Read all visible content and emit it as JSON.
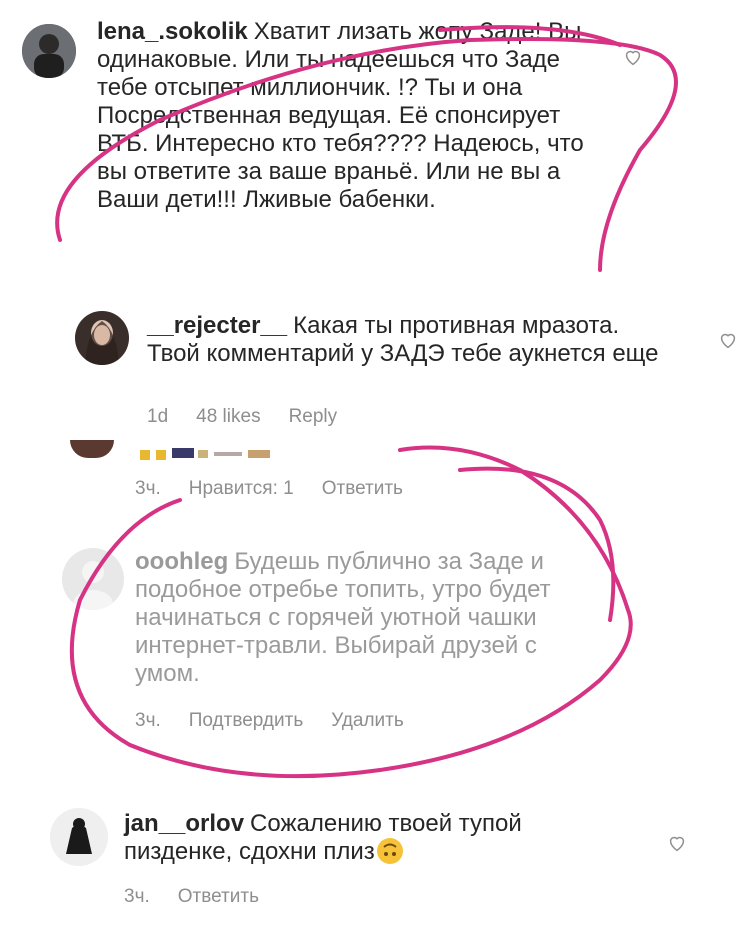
{
  "comments": [
    {
      "username": "lena_.sokolik",
      "text": "Хватит лизать жопу Заде! Вы одинаковые. Или ты надеешься что Заде тебе отсыпет миллиончик. !? Ты и она Посредственная ведущая. Её спонсирует ВТБ. Интересно кто тебя???? Надеюсь, что вы ответите за ваше враньё. Или не вы а Ваши дети!!! Лживые бабенки."
    },
    {
      "username": "__rejecter__",
      "text": "Какая ты противная мразота. Твой комментарий у ЗАДЭ тебе аукнется еще",
      "time": "1d",
      "likes": "48 likes",
      "reply": "Reply"
    },
    {
      "partial_text": "⌐. ⌐. ▬▬ ⌐.⌐.",
      "time": "3ч.",
      "likes": "Нравится: 1",
      "reply": "Ответить"
    },
    {
      "username": "ooohleg",
      "text": "Будешь публично за Заде и подобное отребье топить, утро будет начинаться с горячей уютной чашки интернет-травли. Выбирай друзей с умом.",
      "time": "3ч.",
      "confirm": "Подтвердить",
      "delete": "Удалить"
    },
    {
      "username": "jan__orlov",
      "text": "Сожалению твоей тупой пизденке, сдохни плиз",
      "time": "3ч.",
      "reply": "Ответить"
    }
  ],
  "icons": {
    "heart": "heart-outline-icon",
    "emoji": "upside-down-face-emoji-icon"
  },
  "colors": {
    "annotation": "#d63384",
    "meta": "#8e8e8e",
    "text": "#262626"
  }
}
